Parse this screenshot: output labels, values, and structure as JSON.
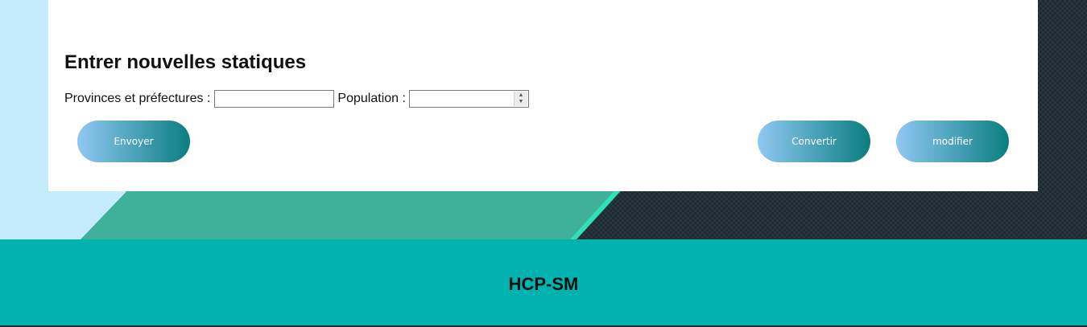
{
  "form": {
    "title": "Entrer nouvelles statiques",
    "province_label": "Provinces et préfectures :",
    "province_value": "",
    "population_label": "Population :",
    "population_value": ""
  },
  "buttons": {
    "send": "Envoyer",
    "convert": "Convertir",
    "modify": "modifier"
  },
  "footer": {
    "title": "HCP-SM"
  },
  "colors": {
    "footer_bg": "#00b2b0",
    "button_gradient_start": "#90c8f4",
    "button_gradient_end": "#0a7e80"
  }
}
